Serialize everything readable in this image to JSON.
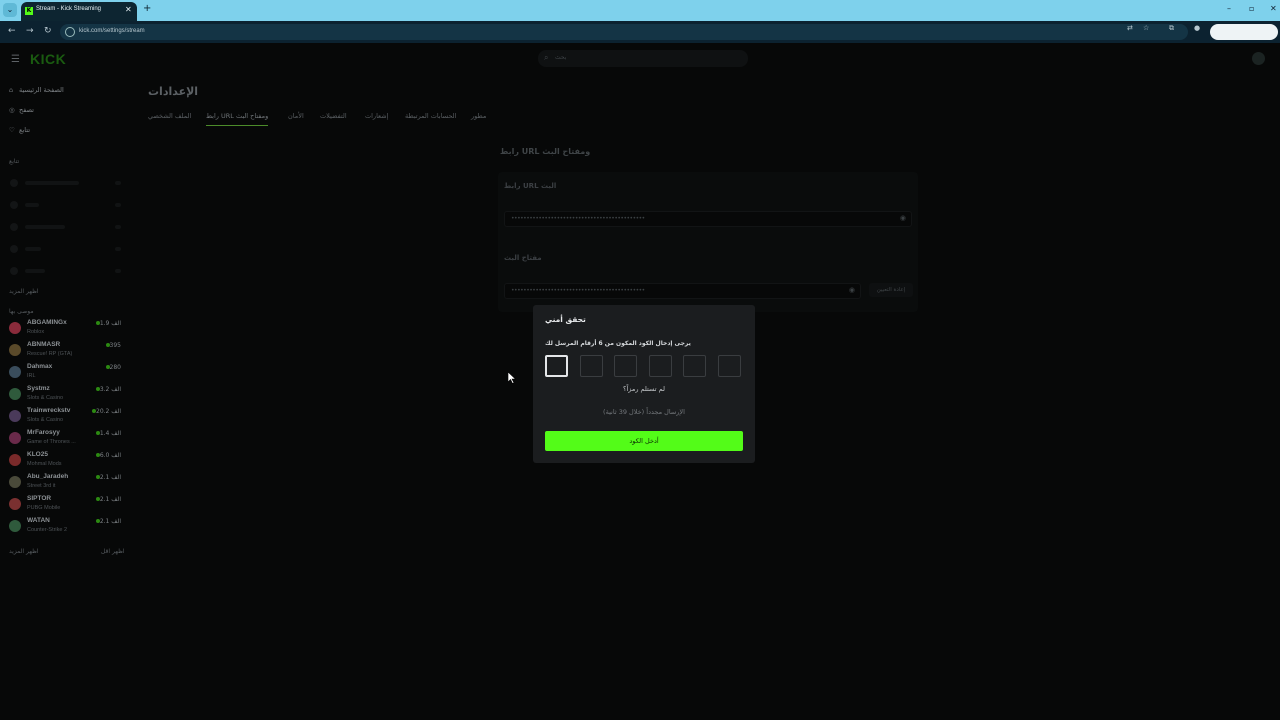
{
  "browser": {
    "tab_title": "Stream - Kick Streaming",
    "tab_favicon": "K",
    "tab_close": "✕",
    "new_tab": "+",
    "url": "kick.com/settings/stream",
    "win_min": "–",
    "win_max": "▫",
    "win_close": "✕"
  },
  "header": {
    "logo": "KICK",
    "search_placeholder": "بحث"
  },
  "sidebar": {
    "nav": [
      {
        "label": "الصفحة الرئيسية",
        "icon": "home-icon"
      },
      {
        "label": "تصفح",
        "icon": "compass-icon"
      },
      {
        "label": "تتابع",
        "icon": "heart-icon"
      }
    ],
    "following_heading": "تتابع",
    "show_more_1": "اظهر المزيد",
    "recommended_heading": "موصى بها",
    "recommended": [
      {
        "name": "ABGAMINGx",
        "game": "Roblox",
        "viewers": "1.9 الف",
        "color": "#8a2b3b"
      },
      {
        "name": "ABNMASR",
        "game": "Rescue! RP (GTA)",
        "viewers": "395",
        "color": "#5a4a2a"
      },
      {
        "name": "Dahmax",
        "game": "IRL",
        "viewers": "280",
        "color": "#3a4d5c"
      },
      {
        "name": "Systmz",
        "game": "Slots & Casino",
        "viewers": "3.2 الف",
        "color": "#2f5a3c"
      },
      {
        "name": "Trainwreckstv",
        "game": "Slots & Casino",
        "viewers": "20.2 الف",
        "color": "#4a3a5a"
      },
      {
        "name": "MrFarosyy",
        "game": "Game of Thrones ...",
        "viewers": "1.4 الف",
        "color": "#6a2a4a"
      },
      {
        "name": "KLO25",
        "game": "Mohmal Mods",
        "viewers": "6.0 الف",
        "color": "#7a2a2a"
      },
      {
        "name": "Abu_Jaradeh",
        "game": "Street 3rd it",
        "viewers": "2.1 الف",
        "color": "#4a4a3a"
      },
      {
        "name": "SIPTOR",
        "game": "PUBG Mobile",
        "viewers": "2.1 الف",
        "color": "#7a3030"
      },
      {
        "name": "WATAN",
        "game": "Counter-Strike 2",
        "viewers": "2.1 الف",
        "color": "#2f5a3c"
      }
    ],
    "show_more_2": "اظهر المزيد",
    "show_less": "اظهر اقل"
  },
  "settings": {
    "page_title": "الإعدادات",
    "tabs": [
      "مطور",
      "الحسابات المرتبطة",
      "إشعارات",
      "التفضيلات",
      "الأمان",
      "رابط URL ومفتاح البث",
      "الملف الشخصي"
    ],
    "active_tab_index": 5,
    "section_title": "رابط URL ومفتاح البث",
    "url_label": "رابط URL البث",
    "url_mask": "••••••••••••••••••••••••••••••••••••••••••••",
    "key_label": "مفتاح البث",
    "key_mask": "••••••••••••••••••••••••••••••••••••••••••••",
    "reset_label": "إعادة التعيين"
  },
  "modal": {
    "title": "تحقق أمني",
    "instruction": "يرجى إدخال الكود المكون من 6 أرقام المرسل لك",
    "code_digits": 6,
    "no_code": "لم تستلم رمزاً؟",
    "resend": "الإرسال مجدداً (خلال 39 ثانية)",
    "submit_label": "أدخل الكود",
    "accent": "#53fc18"
  }
}
